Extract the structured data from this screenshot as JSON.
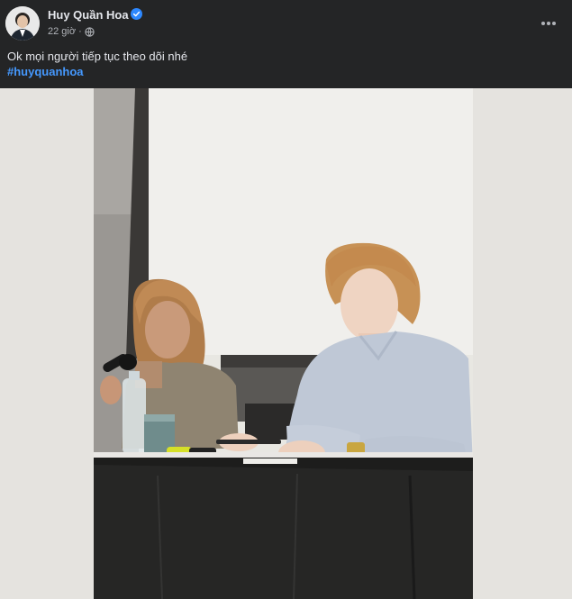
{
  "post": {
    "author": "Huy Quần Hoa",
    "time": "22 giờ",
    "separator": "·",
    "caption": "Ok mọi người tiếp tục theo dõi nhé",
    "hashtag": "#huyquanhoa",
    "more_label": "•••"
  },
  "colors": {
    "background": "#242526",
    "text": "#e4e6eb",
    "meta_text": "#b0b3b8",
    "link": "#4599ff",
    "verified": "#2d88ff"
  },
  "icons": {
    "verified": "verified-badge-icon",
    "privacy": "globe-icon",
    "more": "more-horizontal-icon"
  }
}
